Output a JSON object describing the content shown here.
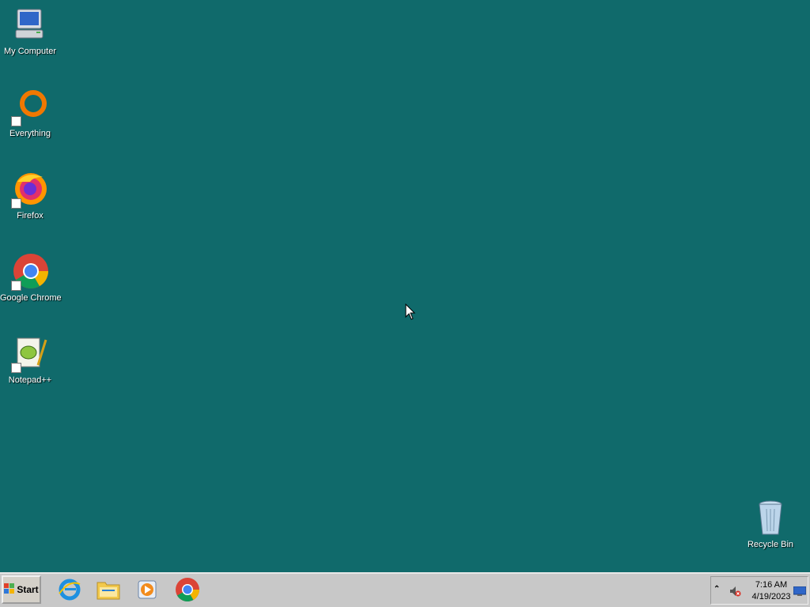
{
  "desktop": {
    "background": "#106a6b",
    "icons": [
      {
        "label": "My Computer",
        "icon": "my-computer-icon"
      },
      {
        "label": "Everything",
        "icon": "everything-icon"
      },
      {
        "label": "Firefox",
        "icon": "firefox-icon"
      },
      {
        "label": "Google Chrome",
        "icon": "google-chrome-icon"
      },
      {
        "label": "Notepad++",
        "icon": "notepadpp-icon"
      }
    ],
    "recycle_bin": {
      "label": "Recycle Bin",
      "icon": "recycle-bin-icon"
    }
  },
  "taskbar": {
    "start_label": "Start",
    "pinned": [
      {
        "name": "Internet Explorer",
        "icon": "internet-explorer-icon"
      },
      {
        "name": "Windows Explorer",
        "icon": "folder-icon"
      },
      {
        "name": "Windows Media Player",
        "icon": "media-player-icon"
      },
      {
        "name": "Google Chrome",
        "icon": "chrome-icon"
      }
    ],
    "tray": {
      "time": "7:16 AM",
      "date": "4/19/2023"
    }
  }
}
